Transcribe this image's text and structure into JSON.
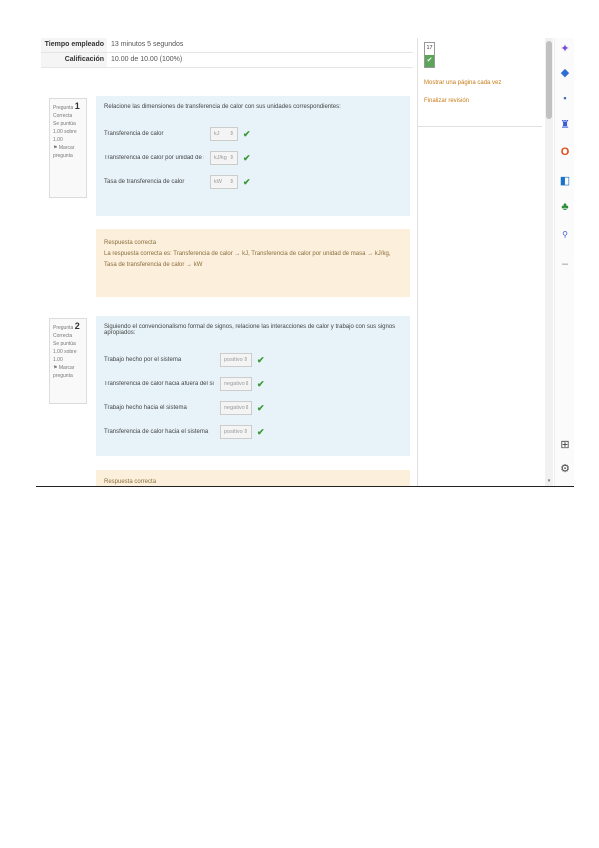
{
  "summary": [
    {
      "label": "Tiempo empleado",
      "value": "13 minutos 5 segundos"
    },
    {
      "label": "Calificación",
      "value": "10.00 de 10.00 (100%)"
    }
  ],
  "questions": [
    {
      "number_prefix": "Pregunta",
      "number": "1",
      "status": "Correcta",
      "score": "Se puntúa 1.00 sobre 1.00",
      "flag_label": "Marcar pregunta",
      "text": "Relacione las dimensiones de transferencia de calor con sus unidades correspondientes:",
      "rows": [
        {
          "label": "Transferencia de calor",
          "selected": "kJ"
        },
        {
          "label": "Transferencia de calor por unidad de masa",
          "selected": "kJ/kg"
        },
        {
          "label": "Tasa de transferencia de calor",
          "selected": "kW"
        }
      ],
      "feedback_title": "Respuesta correcta",
      "feedback_text": "La respuesta correcta es: Transferencia de calor → kJ, Transferencia de calor por unidad de masa → kJ/kg, Tasa de transferencia de calor → kW"
    },
    {
      "number_prefix": "Pregunta",
      "number": "2",
      "status": "Correcta",
      "score": "Se puntúa 1.00 sobre 1.00",
      "flag_label": "Marcar pregunta",
      "text": "Siguiendo el convencionalismo formal de signos, relacione las interacciones de calor y trabajo con sus signos apropiados:",
      "rows": [
        {
          "label": "Trabajo hecho por el sistema",
          "selected": "positivo"
        },
        {
          "label": "Transferencia de calor hacia afuera del sistema",
          "selected": "negativo"
        },
        {
          "label": "Trabajo hecho hacia el sistema",
          "selected": "negativo"
        },
        {
          "label": "Transferencia de calor hacia el sistema",
          "selected": "positivo"
        }
      ],
      "feedback_title": "Respuesta correcta"
    }
  ],
  "nav": {
    "button_number": "17",
    "links": [
      "Mostrar una página cada vez",
      "Finalizar revisión"
    ]
  },
  "colors": {
    "question_bg": "#e7f3f9",
    "feedback_bg": "#fcefdc",
    "correct": "#5aa55a",
    "link": "#c87a18"
  },
  "edge_icons": [
    "sparkle-icon",
    "tag-icon",
    "briefcase-icon",
    "chess-icon",
    "office-icon",
    "outlook-icon",
    "tree-icon",
    "search-icon",
    "minus-icon",
    "sidebar-toggle-icon",
    "settings-icon"
  ]
}
